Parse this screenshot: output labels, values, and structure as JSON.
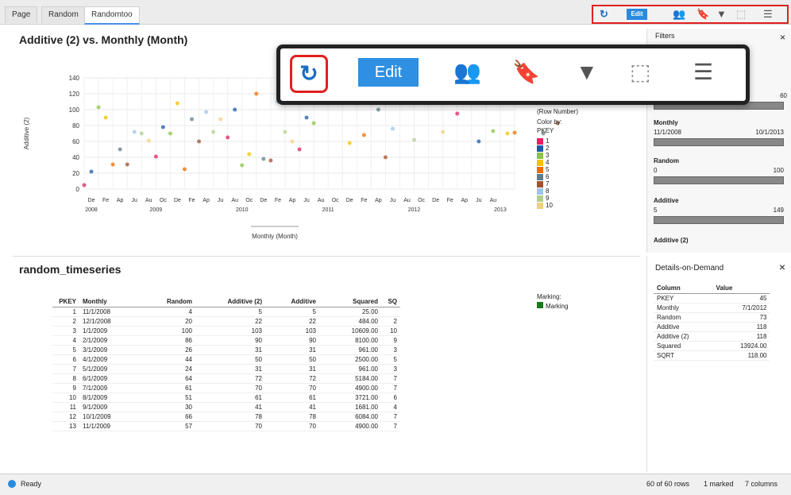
{
  "tabs": [
    "Page",
    "Random",
    "Randomtoo"
  ],
  "toolbar": {
    "edit_label": "Edit"
  },
  "overlay": {
    "edit_label": "Edit"
  },
  "chart_title": "Additive (2) vs. Monthly (Month)",
  "chart_data": {
    "type": "scatter",
    "title": "Additive (2) vs. Monthly (Month)",
    "xlabel": "Monthly (Month)",
    "ylabel": "Additive (2)",
    "ylim": [
      0,
      140
    ],
    "yticks": [
      0,
      20,
      40,
      60,
      80,
      100,
      120,
      140
    ],
    "xtick_months": [
      "De",
      "Fe",
      "Ap",
      "Ju",
      "Au",
      "Oc",
      "De",
      "Fe",
      "Ap",
      "Ju",
      "Au",
      "Oc",
      "De",
      "Fe",
      "Ap",
      "Ju",
      "Au",
      "Oc",
      "De",
      "Fe",
      "Ap",
      "Ju",
      "Au",
      "Oc",
      "De",
      "Fe",
      "Ap",
      "Ju",
      "Au"
    ],
    "xtick_years": [
      "2008",
      "2009",
      "2010",
      "2011",
      "2012",
      "2013"
    ],
    "points": [
      {
        "x": 0,
        "y": 5
      },
      {
        "x": 1,
        "y": 22
      },
      {
        "x": 2,
        "y": 103
      },
      {
        "x": 3,
        "y": 90
      },
      {
        "x": 4,
        "y": 31
      },
      {
        "x": 5,
        "y": 50
      },
      {
        "x": 6,
        "y": 31
      },
      {
        "x": 7,
        "y": 72
      },
      {
        "x": 8,
        "y": 70
      },
      {
        "x": 9,
        "y": 61
      },
      {
        "x": 10,
        "y": 41
      },
      {
        "x": 11,
        "y": 78
      },
      {
        "x": 12,
        "y": 70
      },
      {
        "x": 13,
        "y": 108
      },
      {
        "x": 14,
        "y": 25
      },
      {
        "x": 15,
        "y": 88
      },
      {
        "x": 16,
        "y": 60
      },
      {
        "x": 17,
        "y": 97
      },
      {
        "x": 18,
        "y": 72
      },
      {
        "x": 19,
        "y": 88
      },
      {
        "x": 20,
        "y": 65
      },
      {
        "x": 21,
        "y": 100
      },
      {
        "x": 22,
        "y": 30
      },
      {
        "x": 23,
        "y": 44
      },
      {
        "x": 24,
        "y": 120
      },
      {
        "x": 25,
        "y": 38
      },
      {
        "x": 26,
        "y": 36
      },
      {
        "x": 27,
        "y": 110
      },
      {
        "x": 28,
        "y": 72
      },
      {
        "x": 29,
        "y": 60
      },
      {
        "x": 30,
        "y": 50
      },
      {
        "x": 31,
        "y": 90
      },
      {
        "x": 32,
        "y": 83
      },
      {
        "x": 37,
        "y": 58
      },
      {
        "x": 39,
        "y": 68
      },
      {
        "x": 41,
        "y": 100
      },
      {
        "x": 42,
        "y": 40
      },
      {
        "x": 43,
        "y": 76
      },
      {
        "x": 46,
        "y": 62
      },
      {
        "x": 50,
        "y": 72
      },
      {
        "x": 52,
        "y": 95
      },
      {
        "x": 55,
        "y": 60
      },
      {
        "x": 57,
        "y": 73
      },
      {
        "x": 59,
        "y": 70
      },
      {
        "x": 60,
        "y": 71
      },
      {
        "x": 64,
        "y": 70
      },
      {
        "x": 66,
        "y": 83
      }
    ]
  },
  "legend": {
    "row_number_label": "(Row Number)",
    "color_by_label": "Color by:",
    "color_by_value": "PKEY",
    "items": [
      {
        "label": "1",
        "color": "#e91e63"
      },
      {
        "label": "2",
        "color": "#1e5aa8"
      },
      {
        "label": "3",
        "color": "#8bc34a"
      },
      {
        "label": "4",
        "color": "#f2c200"
      },
      {
        "label": "5",
        "color": "#ef6c00"
      },
      {
        "label": "6",
        "color": "#607d8b"
      },
      {
        "label": "7",
        "color": "#a0522d"
      },
      {
        "label": "8",
        "color": "#9ec5e8"
      },
      {
        "label": "9",
        "color": "#b0d090"
      },
      {
        "label": "10",
        "color": "#f0d080"
      }
    ]
  },
  "filters": {
    "title": "Filters",
    "items": [
      {
        "label": "Monthly",
        "from": "11/1/2008",
        "to": "10/1/2013"
      },
      {
        "label": "Random",
        "from": "0",
        "to": "100"
      },
      {
        "label": "Additive",
        "from": "5",
        "to": "149"
      },
      {
        "label": "Additive (2)",
        "from": "",
        "to": ""
      }
    ],
    "top_value": "60"
  },
  "table": {
    "title": "random_timeseries",
    "columns": [
      "PKEY",
      "Monthly",
      "Random",
      "Additive (2)",
      "Additive",
      "Squared",
      "SQ"
    ],
    "rows": [
      [
        "1",
        "11/1/2008",
        "4",
        "5",
        "5",
        "25.00",
        ""
      ],
      [
        "2",
        "12/1/2008",
        "20",
        "22",
        "22",
        "484.00",
        "2"
      ],
      [
        "3",
        "1/1/2009",
        "100",
        "103",
        "103",
        "10609.00",
        "10"
      ],
      [
        "4",
        "2/1/2009",
        "86",
        "90",
        "90",
        "8100.00",
        "9"
      ],
      [
        "5",
        "3/1/2009",
        "26",
        "31",
        "31",
        "961.00",
        "3"
      ],
      [
        "6",
        "4/1/2009",
        "44",
        "50",
        "50",
        "2500.00",
        "5"
      ],
      [
        "7",
        "5/1/2009",
        "24",
        "31",
        "31",
        "961.00",
        "3"
      ],
      [
        "8",
        "6/1/2009",
        "64",
        "72",
        "72",
        "5184.00",
        "7"
      ],
      [
        "9",
        "7/1/2009",
        "61",
        "70",
        "70",
        "4900.00",
        "7"
      ],
      [
        "10",
        "8/1/2009",
        "51",
        "61",
        "61",
        "3721.00",
        "6"
      ],
      [
        "11",
        "9/1/2009",
        "30",
        "41",
        "41",
        "1681.00",
        "4"
      ],
      [
        "12",
        "10/1/2009",
        "66",
        "78",
        "78",
        "6084.00",
        "7"
      ],
      [
        "13",
        "11/1/2009",
        "57",
        "70",
        "70",
        "4900.00",
        "7"
      ]
    ],
    "marking_label": "Marking:",
    "marking_item": "Marking"
  },
  "details": {
    "title": "Details-on-Demand",
    "headers": [
      "Column",
      "Value"
    ],
    "rows": [
      [
        "PKEY",
        "45"
      ],
      [
        "Monthly",
        "7/1/2012"
      ],
      [
        "Random",
        "73"
      ],
      [
        "Additive",
        "118"
      ],
      [
        "Additive (2)",
        "118"
      ],
      [
        "Squared",
        "13924.00"
      ],
      [
        "SQRT",
        "118.00"
      ]
    ]
  },
  "status": {
    "ready": "Ready",
    "rows": "60 of 60 rows",
    "marked": "1 marked",
    "columns": "7 columns"
  }
}
